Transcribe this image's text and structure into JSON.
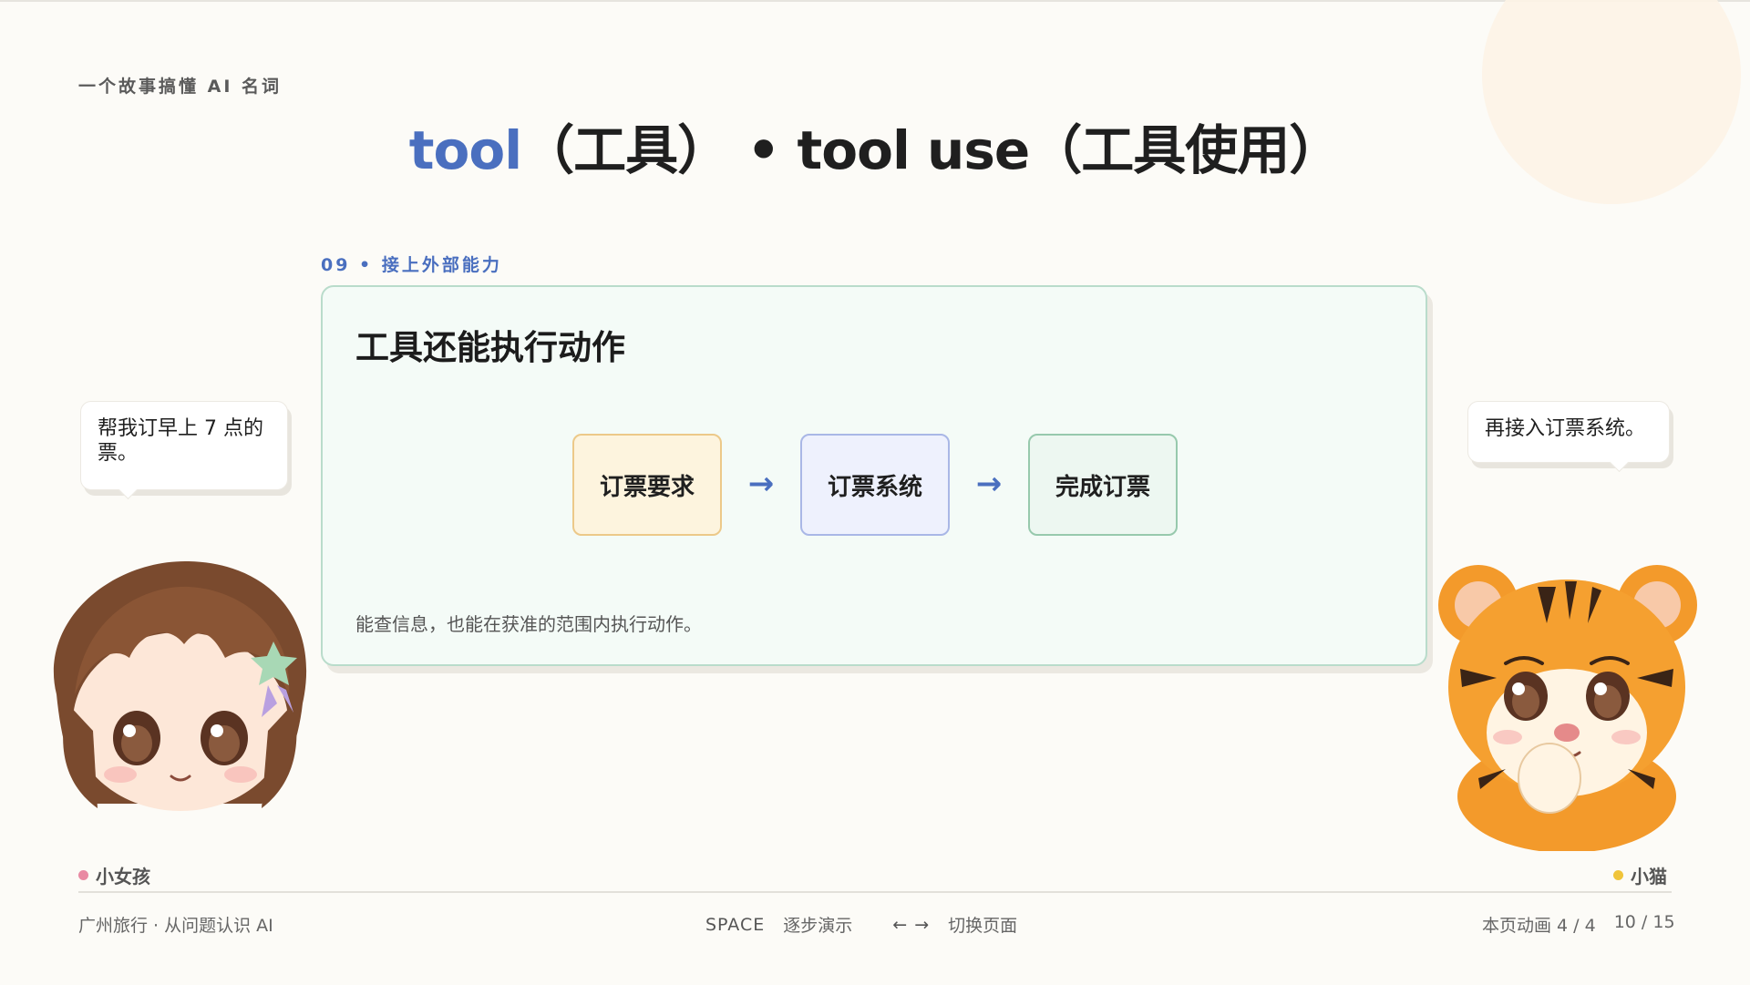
{
  "header": {
    "series": "一个故事搞懂 AI 名词",
    "title_accent": "tool",
    "title_rest": "（工具） • tool use（工具使用）"
  },
  "section": {
    "label": "09 • 接上外部能力"
  },
  "card": {
    "title": "工具还能执行动作",
    "flow": [
      "订票要求",
      "订票系统",
      "完成订票"
    ],
    "arrow": "→",
    "note": "能查信息，也能在获准的范围内执行动作。"
  },
  "bubbles": {
    "girl": "帮我订早上 7 点的票。",
    "tiger": "再接入订票系统。"
  },
  "characters": {
    "girl_name": "小女孩",
    "tiger_name": "小猫"
  },
  "footer": {
    "deck": "广州旅行 · 从问题认识 AI",
    "space_key": "SPACE",
    "space_hint": "逐步演示",
    "arrow_keys": "←  →",
    "arrow_hint": "切换页面",
    "animation": "本页动画 4 / 4",
    "page": "10 / 15"
  },
  "colors": {
    "accent": "#4a6fbf",
    "card_border": "#b9dccb",
    "girl_dot": "#e98aa3",
    "tiger_dot": "#f0c43a"
  }
}
